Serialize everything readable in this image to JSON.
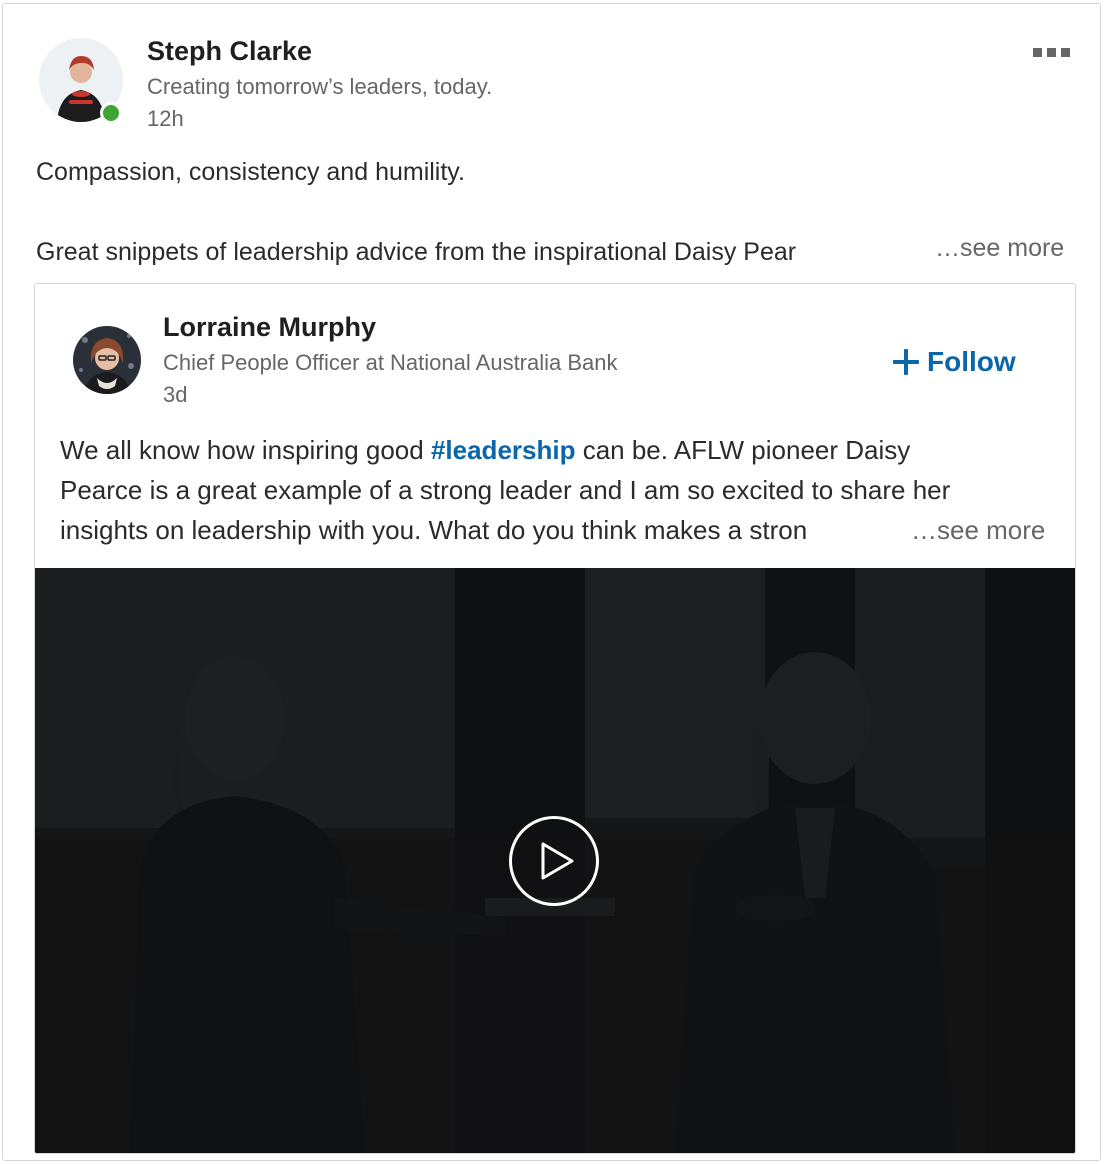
{
  "post": {
    "author": {
      "name": "Steph Clarke",
      "headline": "Creating tomorrow’s leaders, today.",
      "time": "12h"
    },
    "text_line_1": "Compassion, consistency and humility.",
    "text_line_2": "Great snippets of leadership advice from the inspirational Daisy Pear",
    "see_more": "…see more",
    "presence": "online",
    "colors": {
      "presence": "#3fa532",
      "link": "#0a66a8"
    }
  },
  "shared": {
    "author": {
      "name": "Lorraine Murphy",
      "headline": "Chief People Officer at National Australia Bank",
      "time": "3d"
    },
    "follow_label": "Follow",
    "body": {
      "line1_before": "We all know how inspiring good ",
      "hashtag": "#leadership",
      "line1_after": " can be. AFLW pioneer Daisy",
      "line2": "Pearce is a great example of a strong leader and I am so excited to share her",
      "line3": "insights on leadership with you. What do you think makes a stron"
    },
    "see_more": "…see more"
  },
  "icons": [
    "more-menu-icon",
    "plus-icon",
    "play-icon"
  ]
}
